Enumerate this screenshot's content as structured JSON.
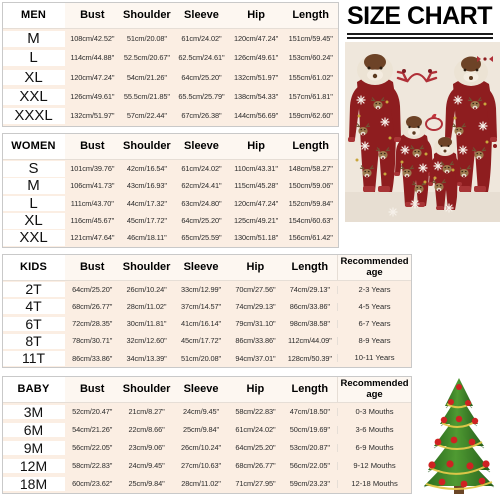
{
  "title": {
    "text": "SIZE CHART"
  },
  "tables": [
    {
      "id": "men",
      "headers": [
        "MEN",
        "Bust",
        "Shoulder",
        "Sleeve",
        "Hip",
        "Length"
      ],
      "rows": [
        [
          "M",
          "108cm/42.52\"",
          "51cm/20.08\"",
          "61cm/24.02\"",
          "120cm/47.24\"",
          "151cm/59.45\""
        ],
        [
          "L",
          "114cm/44.88\"",
          "52.5cm/20.67\"",
          "62.5cm/24.61\"",
          "126cm/49.61\"",
          "153cm/60.24\""
        ],
        [
          "XL",
          "120cm/47.24\"",
          "54cm/21.26\"",
          "64cm/25.20\"",
          "132cm/51.97\"",
          "155cm/61.02\""
        ],
        [
          "XXL",
          "126cm/49.61\"",
          "55.5cm/21.85\"",
          "65.5cm/25.79\"",
          "138cm/54.33\"",
          "157cm/61.81\""
        ],
        [
          "XXXL",
          "132cm/51.97\"",
          "57cm/22.44\"",
          "67cm/26.38\"",
          "144cm/56.69\"",
          "159cm/62.60\""
        ]
      ]
    },
    {
      "id": "women",
      "headers": [
        "WOMEN",
        "Bust",
        "Shoulder",
        "Sleeve",
        "Hip",
        "Length"
      ],
      "rows": [
        [
          "S",
          "101cm/39.76\"",
          "42cm/16.54\"",
          "61cm/24.02\"",
          "110cm/43.31\"",
          "148cm/58.27\""
        ],
        [
          "M",
          "106cm/41.73\"",
          "43cm/16.93\"",
          "62cm/24.41\"",
          "115cm/45.28\"",
          "150cm/59.06\""
        ],
        [
          "L",
          "111cm/43.70\"",
          "44cm/17.32\"",
          "63cm/24.80\"",
          "120cm/47.24\"",
          "152cm/59.84\""
        ],
        [
          "XL",
          "116cm/45.67\"",
          "45cm/17.72\"",
          "64cm/25.20\"",
          "125cm/49.21\"",
          "154cm/60.63\""
        ],
        [
          "XXL",
          "121cm/47.64\"",
          "46cm/18.11\"",
          "65cm/25.59\"",
          "130cm/51.18\"",
          "156cm/61.42\""
        ]
      ]
    },
    {
      "id": "kids",
      "headers": [
        "KIDS",
        "Bust",
        "Shoulder",
        "Sleeve",
        "Hip",
        "Length",
        "Recommended age"
      ],
      "rows": [
        [
          "2T",
          "64cm/25.20\"",
          "26cm/10.24\"",
          "33cm/12.99\"",
          "70cm/27.56\"",
          "74cm/29.13\"",
          "2-3 Years"
        ],
        [
          "4T",
          "68cm/26.77\"",
          "28cm/11.02\"",
          "37cm/14.57\"",
          "74cm/29.13\"",
          "86cm/33.86\"",
          "4-5 Years"
        ],
        [
          "6T",
          "72cm/28.35\"",
          "30cm/11.81\"",
          "41cm/16.14\"",
          "79cm/31.10\"",
          "98cm/38.58\"",
          "6-7 Years"
        ],
        [
          "8T",
          "78cm/30.71\"",
          "32cm/12.60\"",
          "45cm/17.72\"",
          "86cm/33.86\"",
          "112cm/44.09\"",
          "8-9 Years"
        ],
        [
          "11T",
          "86cm/33.86\"",
          "34cm/13.39\"",
          "51cm/20.08\"",
          "94cm/37.01\"",
          "128cm/50.39\"",
          "10-11 Years"
        ]
      ]
    },
    {
      "id": "baby",
      "headers": [
        "BABY",
        "Bust",
        "Shoulder",
        "Sleeve",
        "Hip",
        "Length",
        "Recommended age"
      ],
      "rows": [
        [
          "3M",
          "52cm/20.47\"",
          "21cm/8.27\"",
          "24cm/9.45\"",
          "58cm/22.83\"",
          "47cm/18.50\"",
          "0-3 Mouths"
        ],
        [
          "6M",
          "54cm/21.26\"",
          "22cm/8.66\"",
          "25cm/9.84\"",
          "61cm/24.02\"",
          "50cm/19.69\"",
          "3-6 Mouths"
        ],
        [
          "9M",
          "56cm/22.05\"",
          "23cm/9.06\"",
          "26cm/10.24\"",
          "64cm/25.20\"",
          "53cm/20.87\"",
          "6-9 Mouths"
        ],
        [
          "12M",
          "58cm/22.83\"",
          "24cm/9.45\"",
          "27cm/10.63\"",
          "68cm/26.77\"",
          "56cm/22.05\"",
          "9-12 Mouths"
        ],
        [
          "18M",
          "60cm/23.62\"",
          "25cm/9.84\"",
          "28cm/11.02\"",
          "71cm/27.95\"",
          "59cm/23.23\"",
          "12-18 Mouths"
        ]
      ]
    }
  ],
  "imagery": {
    "family_photo": "family-matching-red-reindeer-onesie-pajamas",
    "christmas_tree": "christmas-tree-with-red-ornaments"
  },
  "colors": {
    "table_fill": "#fbeee3",
    "header_fill": "#fdf7f1",
    "size_col_fill": "#ffffff",
    "border": "#c9c9c9",
    "text": "#1a1a1a",
    "pajama_red": "#8e1d1f",
    "tree_green": "#2f7a22",
    "ornament_red": "#c62828",
    "photo_bg": "#efe7dc"
  }
}
